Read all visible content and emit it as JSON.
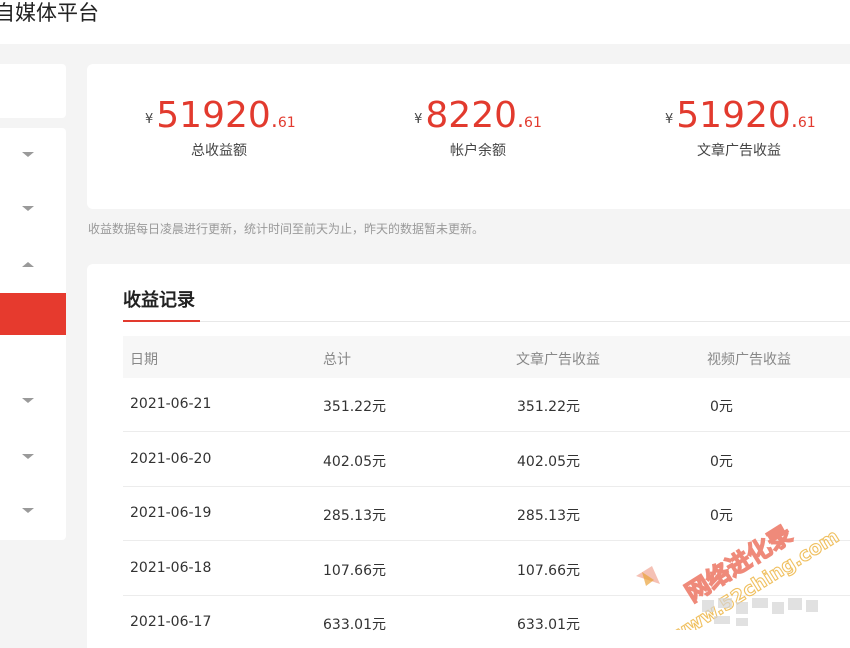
{
  "app": {
    "title": "自媒体平台"
  },
  "stats": [
    {
      "currency": "¥",
      "integer": "51920",
      "dot": ".",
      "decimal": "61",
      "label": "总收益额"
    },
    {
      "currency": "¥",
      "integer": "8220",
      "dot": ".",
      "decimal": "61",
      "label": "帐户余额"
    },
    {
      "currency": "¥",
      "integer": "51920",
      "dot": ".",
      "decimal": "61",
      "label": "文章广告收益"
    }
  ],
  "note": "收益数据每日凌晨进行更新，统计时间至前天为止，昨天的数据暂未更新。",
  "records": {
    "title": "收益记录",
    "columns": [
      "日期",
      "总计",
      "文章广告收益",
      "视频广告收益"
    ],
    "rows": [
      [
        "2021-06-21",
        "351.22元",
        "351.22元",
        "0元"
      ],
      [
        "2021-06-20",
        "402.05元",
        "402.05元",
        "0元"
      ],
      [
        "2021-06-19",
        "285.13元",
        "285.13元",
        "0元"
      ],
      [
        "2021-06-18",
        "107.66元",
        "107.66元",
        ""
      ],
      [
        "2021-06-17",
        "633.01元",
        "633.01元",
        ""
      ]
    ]
  },
  "watermark": {
    "text": "网络进化录",
    "url": "www.52ching.com"
  },
  "colors": {
    "accent": "#e23a2e",
    "sidebar_active": "#e63a2e"
  }
}
